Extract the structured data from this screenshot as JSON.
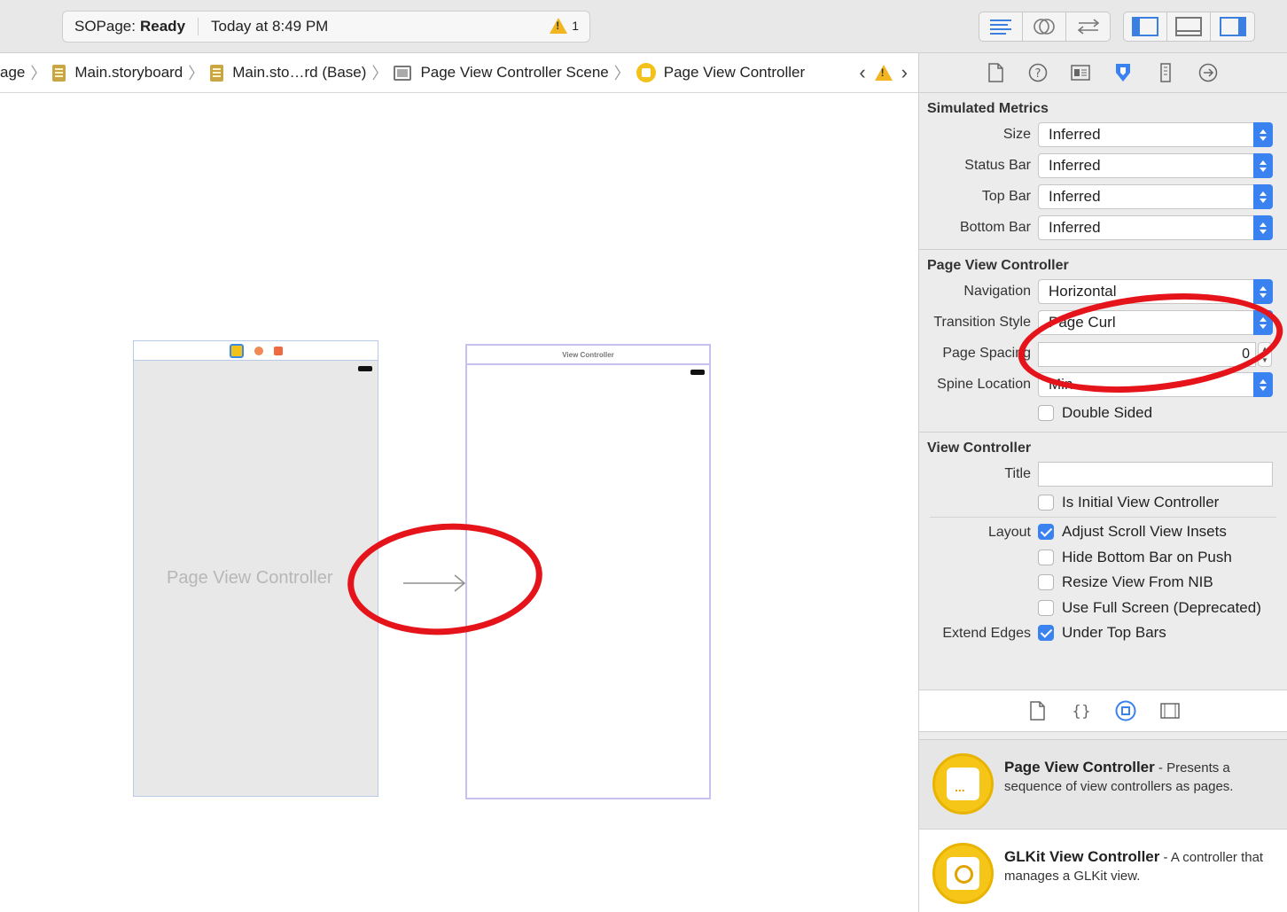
{
  "toolbar": {
    "project": "SOPage:",
    "status": "Ready",
    "time": "Today at 8:49 PM",
    "warning_count": "1",
    "editor_buttons": [
      "standard-editor-icon",
      "assistant-editor-icon",
      "version-editor-icon"
    ],
    "panel_buttons": [
      "navigator-panel-icon",
      "debug-panel-icon",
      "utilities-panel-icon"
    ]
  },
  "jumpbar": {
    "crumbs": [
      "age",
      "Main.storyboard",
      "Main.sto…rd (Base)",
      "Page View Controller Scene",
      "Page View Controller"
    ]
  },
  "canvas": {
    "pvc_label": "Page View Controller",
    "vc_header": "View Controller"
  },
  "inspector": {
    "tabs": [
      "file-icon",
      "help-icon",
      "identity-icon",
      "attributes-icon",
      "size-icon",
      "connections-icon"
    ],
    "simulated_metrics": {
      "title": "Simulated Metrics",
      "rows": [
        {
          "label": "Size",
          "value": "Inferred"
        },
        {
          "label": "Status Bar",
          "value": "Inferred"
        },
        {
          "label": "Top Bar",
          "value": "Inferred"
        },
        {
          "label": "Bottom Bar",
          "value": "Inferred"
        }
      ]
    },
    "page_view_controller": {
      "title": "Page View Controller",
      "navigation_label": "Navigation",
      "navigation_value": "Horizontal",
      "transition_label": "Transition Style",
      "transition_value": "Page Curl",
      "spacing_label": "Page Spacing",
      "spacing_value": "0",
      "spine_label": "Spine Location",
      "spine_value": "Min",
      "double_sided": "Double Sided"
    },
    "view_controller": {
      "title": "View Controller",
      "title_label": "Title",
      "title_value": "",
      "initial": "Is Initial View Controller",
      "layout_label": "Layout",
      "layout": [
        {
          "text": "Adjust Scroll View Insets",
          "checked": true
        },
        {
          "text": "Hide Bottom Bar on Push",
          "checked": false
        },
        {
          "text": "Resize View From NIB",
          "checked": false
        },
        {
          "text": "Use Full Screen (Deprecated)",
          "checked": false
        }
      ],
      "extend_label": "Extend Edges",
      "extend": "Under Top Bars"
    }
  },
  "library": {
    "items": [
      {
        "name": "Page View Controller",
        "desc": " - Presents a sequence of view controllers as pages."
      },
      {
        "name": "GLKit View Controller",
        "desc": " - A controller that manages a GLKit view."
      }
    ]
  },
  "colors": {
    "accent": "#3b82f1",
    "annotation": "#e5141b",
    "warning": "#f2b51f"
  }
}
